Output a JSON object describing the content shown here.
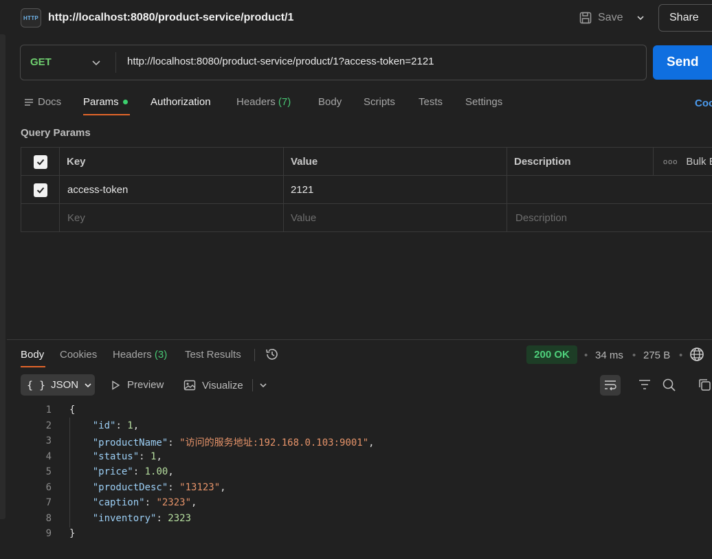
{
  "window": {
    "title": "http://localhost:8080/product-service/product/1",
    "save_label": "Save",
    "share_label": "Share",
    "http_icon_text": "HTTP"
  },
  "request": {
    "method": "GET",
    "url": "http://localhost:8080/product-service/product/1?access-token=2121",
    "send_label": "Send"
  },
  "request_tabs": {
    "docs": "Docs",
    "params": "Params",
    "authorization": "Authorization",
    "headers": "Headers",
    "headers_count": "(7)",
    "body": "Body",
    "scripts": "Scripts",
    "tests": "Tests",
    "settings": "Settings",
    "cookies": "Coo"
  },
  "query_params": {
    "title": "Query Params",
    "headers": {
      "key": "Key",
      "value": "Value",
      "description": "Description",
      "bulk": "Bulk E"
    },
    "rows": [
      {
        "checked": true,
        "key": "access-token",
        "value": "2121",
        "description": ""
      }
    ],
    "placeholders": {
      "key": "Key",
      "value": "Value",
      "description": "Description"
    }
  },
  "response": {
    "tabs": {
      "body": "Body",
      "cookies": "Cookies",
      "headers": "Headers",
      "headers_count": "(3)",
      "test_results": "Test Results"
    },
    "status": "200 OK",
    "time": "34 ms",
    "size": "275 B",
    "format": "JSON",
    "preview_label": "Preview",
    "visualize_label": "Visualize",
    "lines": {
      "l1": "{",
      "id_key": "\"id\"",
      "id_val": "1",
      "pn_key": "\"productName\"",
      "pn_val": "\"访问的服务地址:192.168.0.103:9001\"",
      "st_key": "\"status\"",
      "st_val": "1",
      "pr_key": "\"price\"",
      "pr_val": "1.00",
      "pd_key": "\"productDesc\"",
      "pd_val": "\"13123\"",
      "ca_key": "\"caption\"",
      "ca_val": "\"2323\"",
      "in_key": "\"inventory\"",
      "in_val": "2323",
      "l9": "}"
    },
    "line_numbers": [
      "1",
      "2",
      "3",
      "4",
      "5",
      "6",
      "7",
      "8",
      "9"
    ]
  }
}
